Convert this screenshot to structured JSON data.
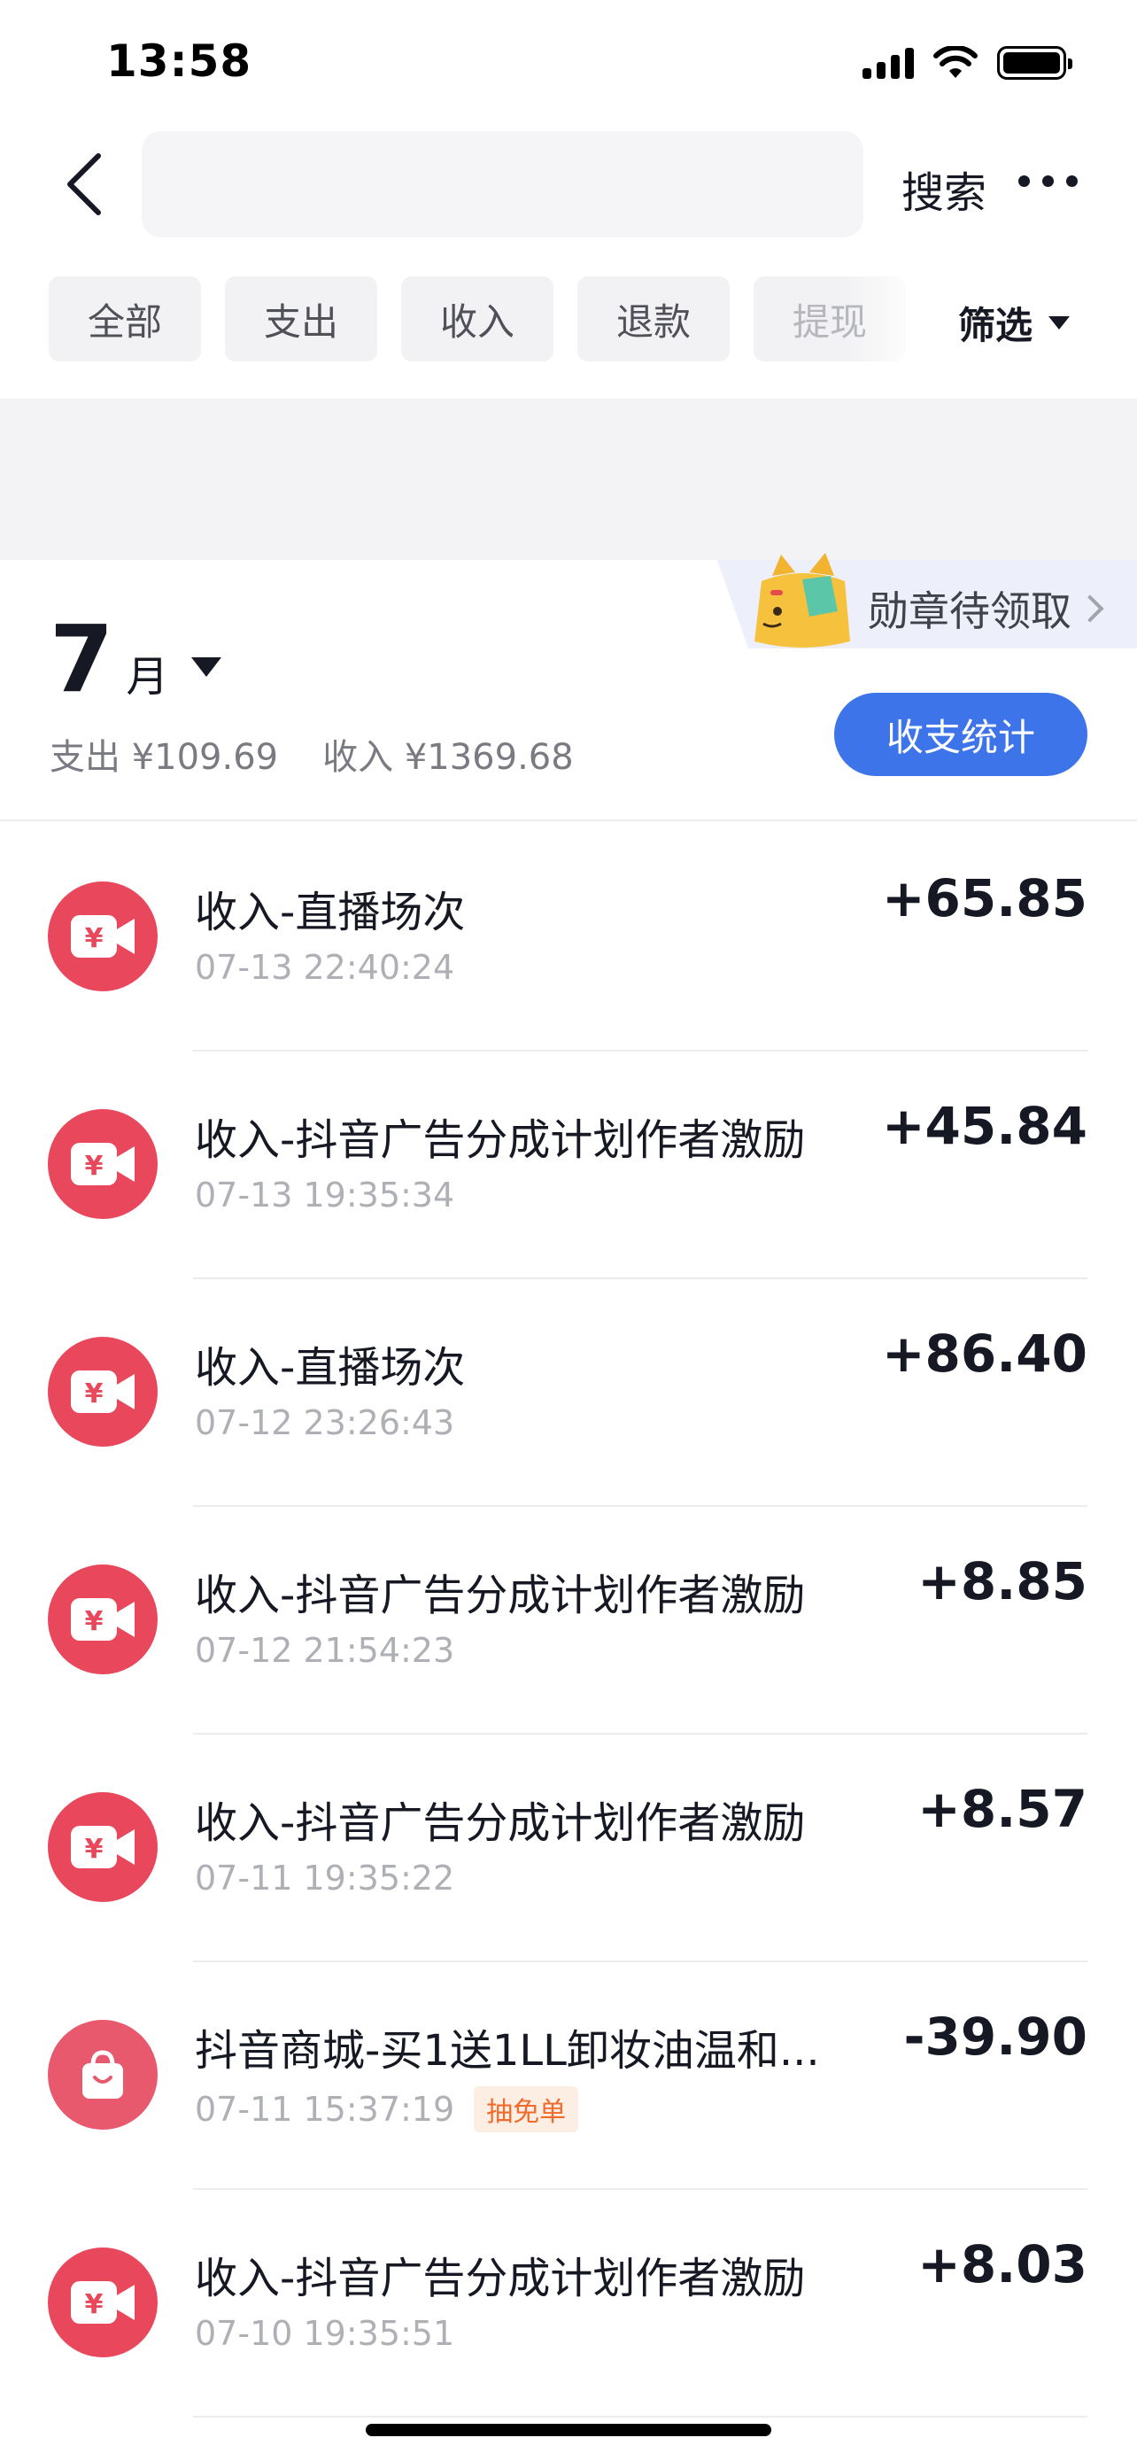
{
  "status_bar": {
    "time": "13:58"
  },
  "header": {
    "search_placeholder": "",
    "search_label": "搜索"
  },
  "tabs": [
    {
      "label": "全部"
    },
    {
      "label": "支出"
    },
    {
      "label": "收入"
    },
    {
      "label": "退款"
    },
    {
      "label": "提现"
    }
  ],
  "filter": {
    "label": "筛选"
  },
  "badge": {
    "label": "勋章待领取"
  },
  "summary": {
    "month": "7",
    "month_unit": "月",
    "expense": "支出 ¥109.69",
    "income": "收入 ¥1369.68",
    "stats_button": "收支统计"
  },
  "transactions": [
    {
      "title": "收入-直播场次",
      "time": "07-13 22:40:24",
      "amount": "+65.85",
      "icon": "video-yuan-icon"
    },
    {
      "title": "收入-抖音广告分成计划作者激励",
      "time": "07-13 19:35:34",
      "amount": "+45.84",
      "icon": "video-yuan-icon"
    },
    {
      "title": "收入-直播场次",
      "time": "07-12 23:26:43",
      "amount": "+86.40",
      "icon": "video-yuan-icon"
    },
    {
      "title": "收入-抖音广告分成计划作者激励",
      "time": "07-12 21:54:23",
      "amount": "+8.85",
      "icon": "video-yuan-icon"
    },
    {
      "title": "收入-抖音广告分成计划作者激励",
      "time": "07-11 19:35:22",
      "amount": "+8.57",
      "icon": "video-yuan-icon"
    },
    {
      "title": "抖音商城-买1送1LL卸妆油温和...",
      "time": "07-11 15:37:19",
      "tag": "抽免单",
      "amount": "-39.90",
      "icon": "shopping-bag-icon"
    },
    {
      "title": "收入-抖音广告分成计划作者激励",
      "time": "07-10 19:35:51",
      "amount": "+8.03",
      "icon": "video-yuan-icon"
    }
  ]
}
